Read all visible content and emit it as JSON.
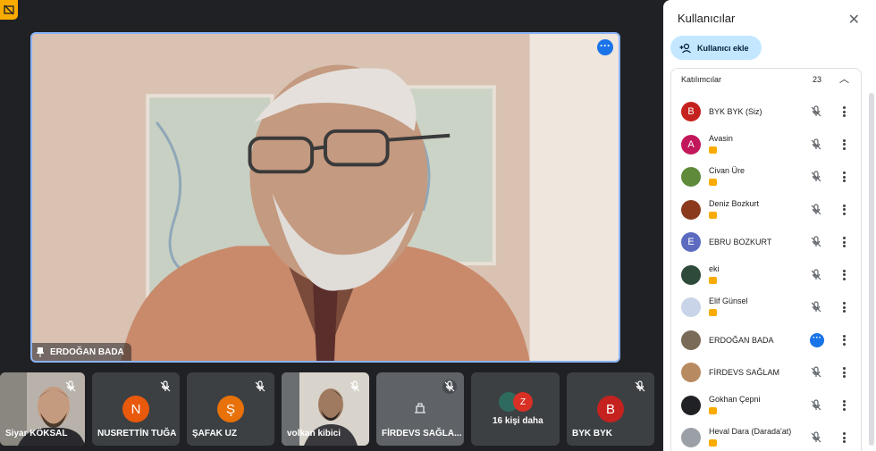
{
  "main_speaker": {
    "name": "ERDOĞAN BADA"
  },
  "strip": [
    {
      "name": "Siyar KÖKSAL",
      "type": "video"
    },
    {
      "name": "NUSRETTİN TUĞA",
      "initial": "N",
      "color": "#e8590c",
      "type": "avatar"
    },
    {
      "name": "ŞAFAK UZ",
      "initial": "Ş",
      "color": "#e8710a",
      "type": "avatar"
    },
    {
      "name": "volkan kibici",
      "type": "video"
    },
    {
      "name": "FİRDEVS SAĞLA...",
      "type": "photo"
    },
    {
      "name": "16 kişi daha",
      "initial": "Z",
      "color": "#d93025",
      "type": "more"
    },
    {
      "name": "BYK BYK",
      "initial": "B",
      "color": "#c5221f",
      "type": "avatar"
    }
  ],
  "panel": {
    "title": "Kullanıcılar",
    "add_button": "Kullanıcı ekle",
    "section_label": "Katılımcılar",
    "count": "23",
    "participants": [
      {
        "name": "BYK BYK (Siz)",
        "initial": "B",
        "color": "#c5221f",
        "badge": false
      },
      {
        "name": "Avasin",
        "initial": "A",
        "color": "#c2185b",
        "badge": true
      },
      {
        "name": "Civan Üre",
        "initial": "",
        "color": "#5f8a3a",
        "badge": true
      },
      {
        "name": "Deniz Bozkurt",
        "initial": "",
        "color": "#8b3a1e",
        "badge": true
      },
      {
        "name": "EBRU BOZKURT",
        "initial": "E",
        "color": "#5c6bc0",
        "badge": false
      },
      {
        "name": "eki",
        "initial": "",
        "color": "#2e4a3a",
        "badge": true
      },
      {
        "name": "Elif Günsel",
        "initial": "",
        "color": "#c9d4e8",
        "badge": true
      },
      {
        "name": "ERDOĞAN BADA",
        "initial": "",
        "color": "#7a6a58",
        "badge": false,
        "speaking": true
      },
      {
        "name": "FİRDEVS SAĞLAM",
        "initial": "",
        "color": "#b88a62",
        "badge": false
      },
      {
        "name": "Gokhan Çepni",
        "initial": "",
        "color": "#202124",
        "badge": true
      },
      {
        "name": "Heval Dara (Darada'at)",
        "initial": "",
        "color": "#9aa0a6",
        "badge": true
      }
    ]
  }
}
